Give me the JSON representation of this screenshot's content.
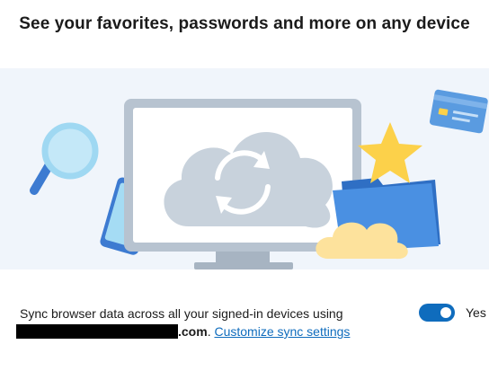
{
  "header": {
    "title": "See your favorites, passwords and more on any device"
  },
  "illustration": {
    "icons": [
      "magnifier-icon",
      "phone-icon",
      "monitor-icon",
      "cloud-sync-icon",
      "star-icon",
      "folder-icon",
      "credit-card-icon",
      "cloud-icon"
    ],
    "colors": {
      "background": "#f0f5fb",
      "monitor_frame": "#b7c3d0",
      "cloud": "#c8d2dc",
      "star": "#fcd14a",
      "folder": "#3f84d6",
      "card": "#5a9be0",
      "small_cloud": "#fde29c",
      "magnifier": "#9fd8f2"
    }
  },
  "sync": {
    "text_before": "Sync browser data across all your signed-in devices using",
    "domain_suffix": ".com",
    "separator": ".",
    "link_label": "Customize sync settings",
    "toggle_label": "Yes",
    "toggle_state": "on"
  }
}
